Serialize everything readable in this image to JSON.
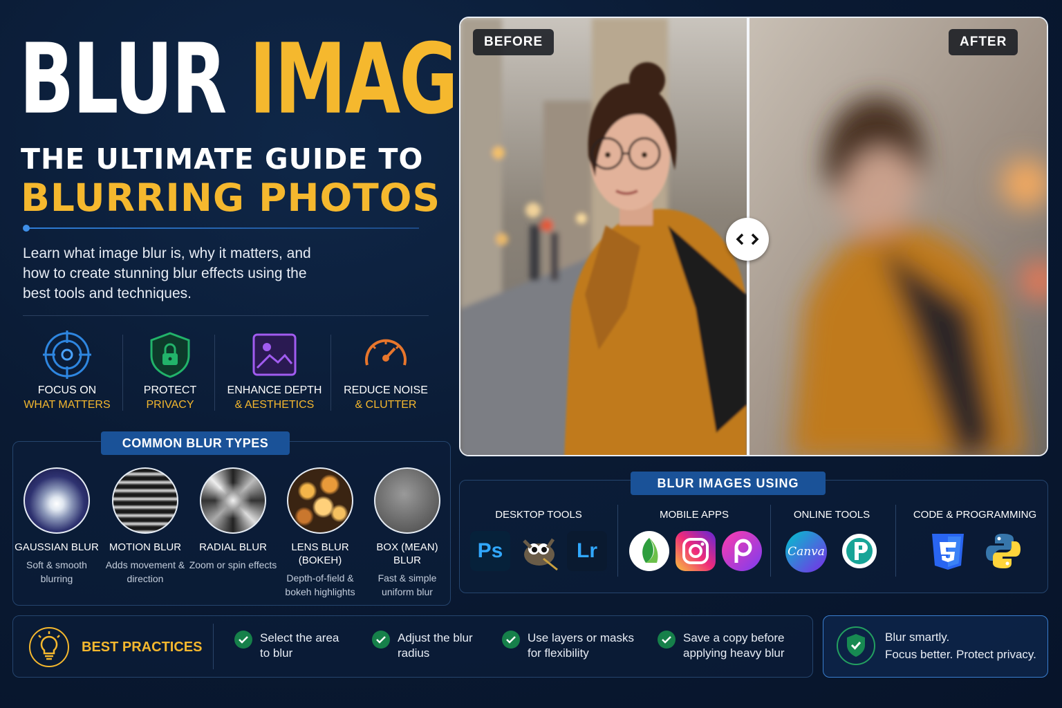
{
  "title": {
    "word1": "BLUR",
    "word2": "IMAGE"
  },
  "subtitle": {
    "line1": "THE ULTIMATE GUIDE TO",
    "line2": "BLURRING PHOTOS"
  },
  "intro": "Learn what image blur is, why it matters, and how to create stunning blur effects using the best tools and techniques.",
  "benefits": [
    {
      "icon": "target-icon",
      "line1": "FOCUS ON",
      "line2": "WHAT MATTERS"
    },
    {
      "icon": "lock-shield-icon",
      "line1": "PROTECT",
      "line2": "PRIVACY"
    },
    {
      "icon": "image-icon",
      "line1": "ENHANCE DEPTH",
      "line2": "& AESTHETICS"
    },
    {
      "icon": "gauge-icon",
      "line1": "REDUCE NOISE",
      "line2": "& CLUTTER"
    }
  ],
  "blur_types": {
    "heading": "COMMON BLUR TYPES",
    "items": [
      {
        "name": "GAUSSIAN BLUR",
        "desc": "Soft & smooth blurring"
      },
      {
        "name": "MOTION BLUR",
        "desc": "Adds movement & direction"
      },
      {
        "name": "RADIAL BLUR",
        "desc": "Zoom or spin effects"
      },
      {
        "name": "LENS BLUR (BOKEH)",
        "desc": "Depth-of-field & bokeh highlights"
      },
      {
        "name": "BOX (MEAN) BLUR",
        "desc": "Fast & simple uniform blur"
      }
    ]
  },
  "compare": {
    "before_label": "BEFORE",
    "after_label": "AFTER"
  },
  "tools": {
    "heading": "BLUR IMAGES USING",
    "categories": [
      {
        "label": "DESKTOP TOOLS",
        "icons": [
          "photoshop-icon",
          "gimp-icon",
          "lightroom-icon"
        ],
        "texts": [
          "Ps",
          "",
          "Lr"
        ]
      },
      {
        "label": "MOBILE APPS",
        "icons": [
          "snapseed-icon",
          "instagram-icon",
          "picsart-icon"
        ]
      },
      {
        "label": "ONLINE TOOLS",
        "icons": [
          "canva-icon",
          "photopea-icon"
        ],
        "texts": [
          "Canva",
          ""
        ]
      },
      {
        "label": "CODE & PROGRAMMING",
        "icons": [
          "css3-icon",
          "python-icon"
        ]
      }
    ]
  },
  "best_practices": {
    "title": "BEST PRACTICES",
    "items": [
      {
        "line1": "Select the area",
        "line2": "to blur"
      },
      {
        "line1": "Adjust the blur",
        "line2": "radius"
      },
      {
        "line1": "Use layers or masks",
        "line2": "for flexibility"
      },
      {
        "line1": "Save a copy before",
        "line2": "applying heavy blur"
      }
    ]
  },
  "tagline": {
    "line1": "Blur smartly.",
    "line2": "Focus better. Protect privacy."
  },
  "colors": {
    "accent": "#f5b82e",
    "blue": "#1a5298",
    "bg": "#0a1a33",
    "check": "#16804a"
  }
}
